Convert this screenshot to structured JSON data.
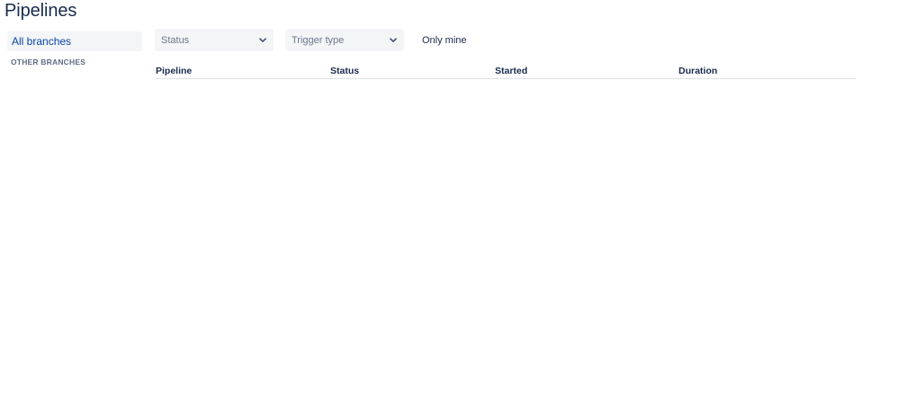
{
  "page": {
    "title": "Pipelines"
  },
  "sidebar": {
    "all_branches_label": "All branches",
    "other_branches_label": "OTHER BRANCHES"
  },
  "filters": {
    "status_placeholder": "Status",
    "trigger_type_placeholder": "Trigger type",
    "only_mine_label": "Only mine"
  },
  "table": {
    "columns": [
      "Pipeline",
      "Status",
      "Started",
      "Duration"
    ],
    "rows": []
  },
  "icons": {
    "dropdown": "chevron-down-icon"
  },
  "colors": {
    "text_primary": "#172b4d",
    "link": "#0747a6",
    "muted": "#5e6c84",
    "field_background": "#f4f5f7",
    "divider": "#dfe1e6"
  }
}
